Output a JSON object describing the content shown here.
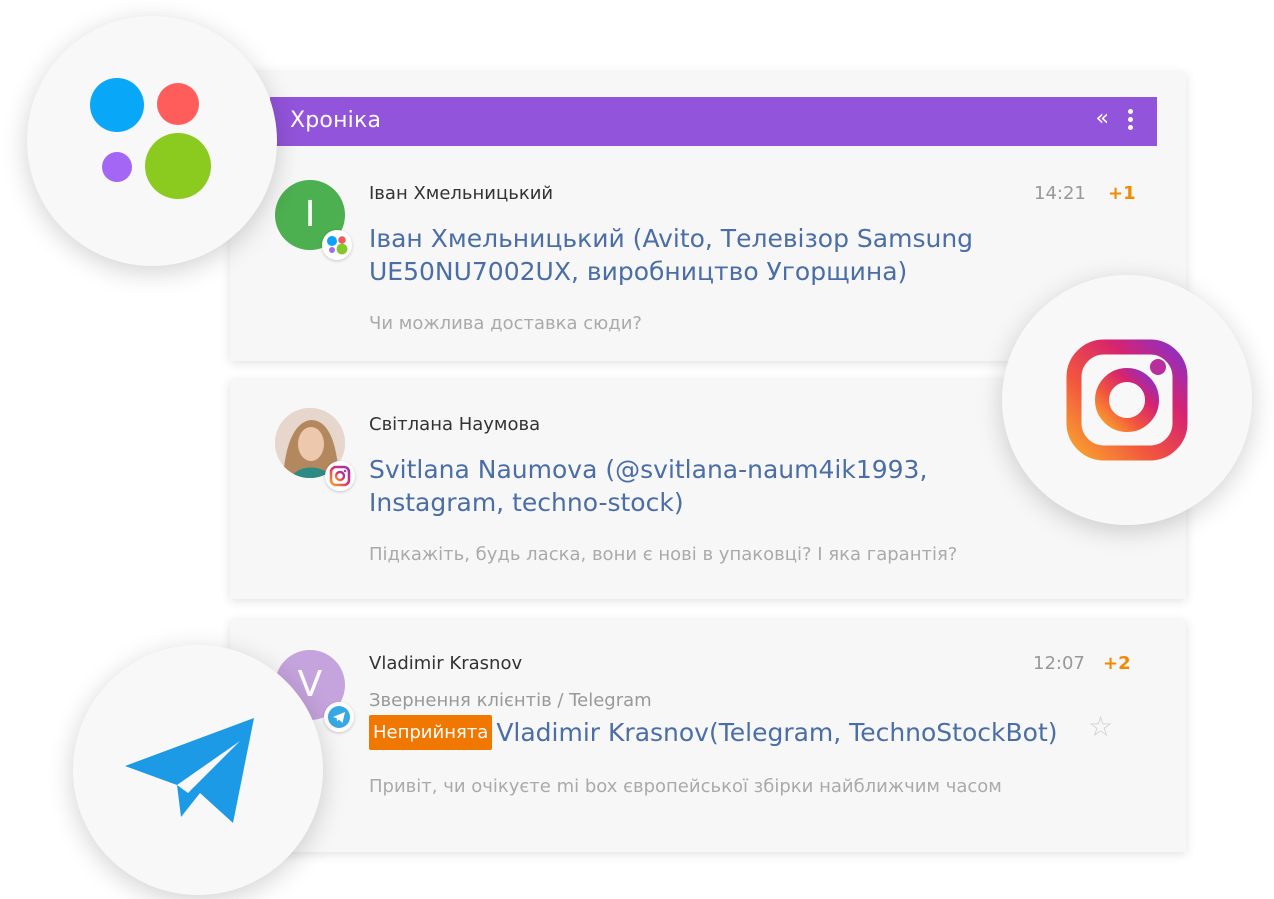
{
  "header": {
    "title": "Хроніка",
    "collapse_glyph": "«"
  },
  "messages": [
    {
      "sender": "Іван Хмельницький",
      "time": "14:21",
      "count": "+1",
      "avatar_letter": "І",
      "avatar_color": "#4caf50",
      "subject_line1": "Іван Хмельницький (Avito, Телевізор Samsung",
      "subject_line2": "UE50NU7002UX, виробництво Угорщина)",
      "preview": "Чи можлива доставка сюди?"
    },
    {
      "sender": "Світлана Наумова",
      "subject_line1": "Svitlana Naumova (@svitlana-naum4ik1993,",
      "subject_line2": "Instagram, techno-stock)",
      "preview": "Підкажіть, будь ласка, вони є нові в упаковці? І яка гарантія?"
    },
    {
      "sender": "Vladimir Krasnov",
      "time": "12:07",
      "count": "+2",
      "avatar_letter": "V",
      "avatar_color": "#c5a3dd",
      "path": "Звернення клієнтів / Telegram",
      "status_tag": "Неприйнята",
      "subject": "Vladimir Krasnov(Telegram, TechnoStockBot)",
      "preview": "Привіт, чи очікуєте mi box європейської збірки найближчим часом"
    }
  ],
  "colors": {
    "header": "#9254db",
    "subject": "#4a6ea5",
    "accent": "#f08a00",
    "tag": "#f07800"
  },
  "icons": [
    "avito-icon",
    "instagram-icon",
    "telegram-icon",
    "star-icon",
    "kebab-menu-icon"
  ]
}
